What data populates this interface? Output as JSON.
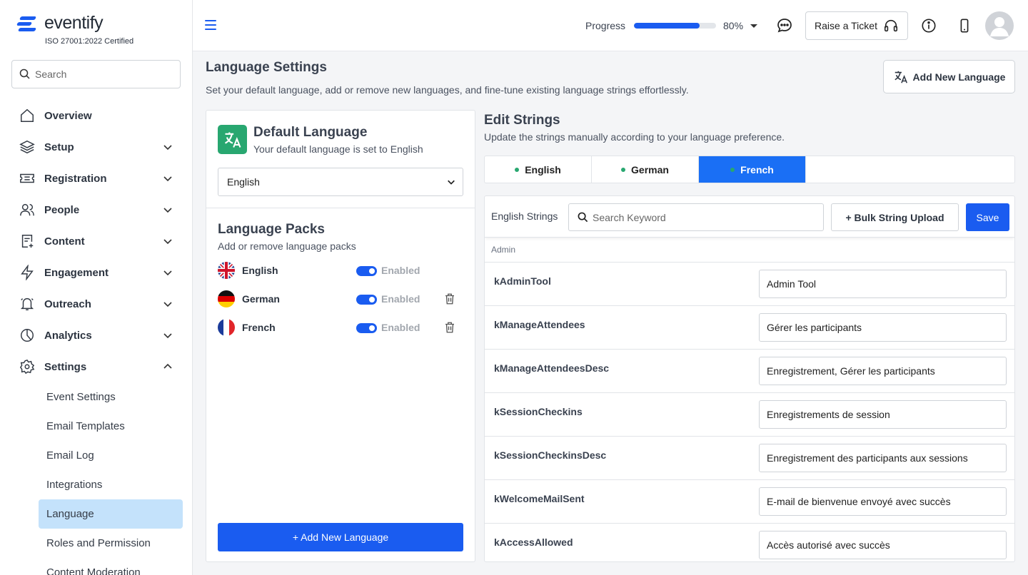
{
  "brand": {
    "name": "eventify",
    "certification": "ISO 27001:2022 Certified",
    "color": "#1a5cf0"
  },
  "sidebar": {
    "search_placeholder": "Search",
    "items": [
      {
        "label": "Overview",
        "icon": "home-icon"
      },
      {
        "label": "Setup",
        "icon": "layers-icon"
      },
      {
        "label": "Registration",
        "icon": "ticket-icon"
      },
      {
        "label": "People",
        "icon": "users-icon"
      },
      {
        "label": "Content",
        "icon": "file-plus-icon"
      },
      {
        "label": "Engagement",
        "icon": "bolt-icon"
      },
      {
        "label": "Outreach",
        "icon": "bell-icon"
      },
      {
        "label": "Analytics",
        "icon": "pie-chart-icon"
      },
      {
        "label": "Settings",
        "icon": "gear-icon"
      }
    ],
    "settings_sub": [
      "Event Settings",
      "Email Templates",
      "Email Log",
      "Integrations",
      "Language",
      "Roles and Permission",
      "Content Moderation"
    ],
    "active_sub": "Language"
  },
  "topbar": {
    "progress_label": "Progress",
    "progress_value": 0.8,
    "progress_text": "80%",
    "ticket_label": "Raise a Ticket"
  },
  "page": {
    "title": "Language Settings",
    "subtitle": "Set your default language, add or remove new languages, and fine-tune existing language strings effortlessly.",
    "add_language_label": "Add New Language"
  },
  "default_language": {
    "title": "Default Language",
    "subtitle": "Your default language is set to English",
    "selected": "English"
  },
  "language_packs": {
    "title": "Language Packs",
    "subtitle": "Add or remove language packs",
    "items": [
      {
        "name": "English",
        "status": "Enabled",
        "flag": "uk-flag-icon",
        "deletable": false
      },
      {
        "name": "German",
        "status": "Enabled",
        "flag": "germany-flag-icon",
        "deletable": true
      },
      {
        "name": "French",
        "status": "Enabled",
        "flag": "france-flag-icon",
        "deletable": true
      }
    ],
    "add_button_label": "+ Add New Language"
  },
  "edit_strings": {
    "title": "Edit Strings",
    "subtitle": "Update the strings manually according to your language preference.",
    "tabs": [
      "English",
      "German",
      "French"
    ],
    "active_tab": "French",
    "toolbar_label": "English Strings",
    "search_placeholder": "Search Keyword",
    "bulk_upload_label": "+ Bulk String Upload",
    "save_label": "Save",
    "group": "Admin",
    "rows": [
      {
        "key": "kAdminTool",
        "value": "Admin Tool"
      },
      {
        "key": "kManageAttendees",
        "value": "Gérer les participants"
      },
      {
        "key": "kManageAttendeesDesc",
        "value": "Enregistrement, Gérer les participants"
      },
      {
        "key": "kSessionCheckins",
        "value": "Enregistrements de session"
      },
      {
        "key": "kSessionCheckinsDesc",
        "value": "Enregistrement des participants aux sessions"
      },
      {
        "key": "kWelcomeMailSent",
        "value": "E-mail de bienvenue envoyé avec succès"
      },
      {
        "key": "kAccessAllowed",
        "value": "Accès autorisé avec succès"
      }
    ]
  }
}
